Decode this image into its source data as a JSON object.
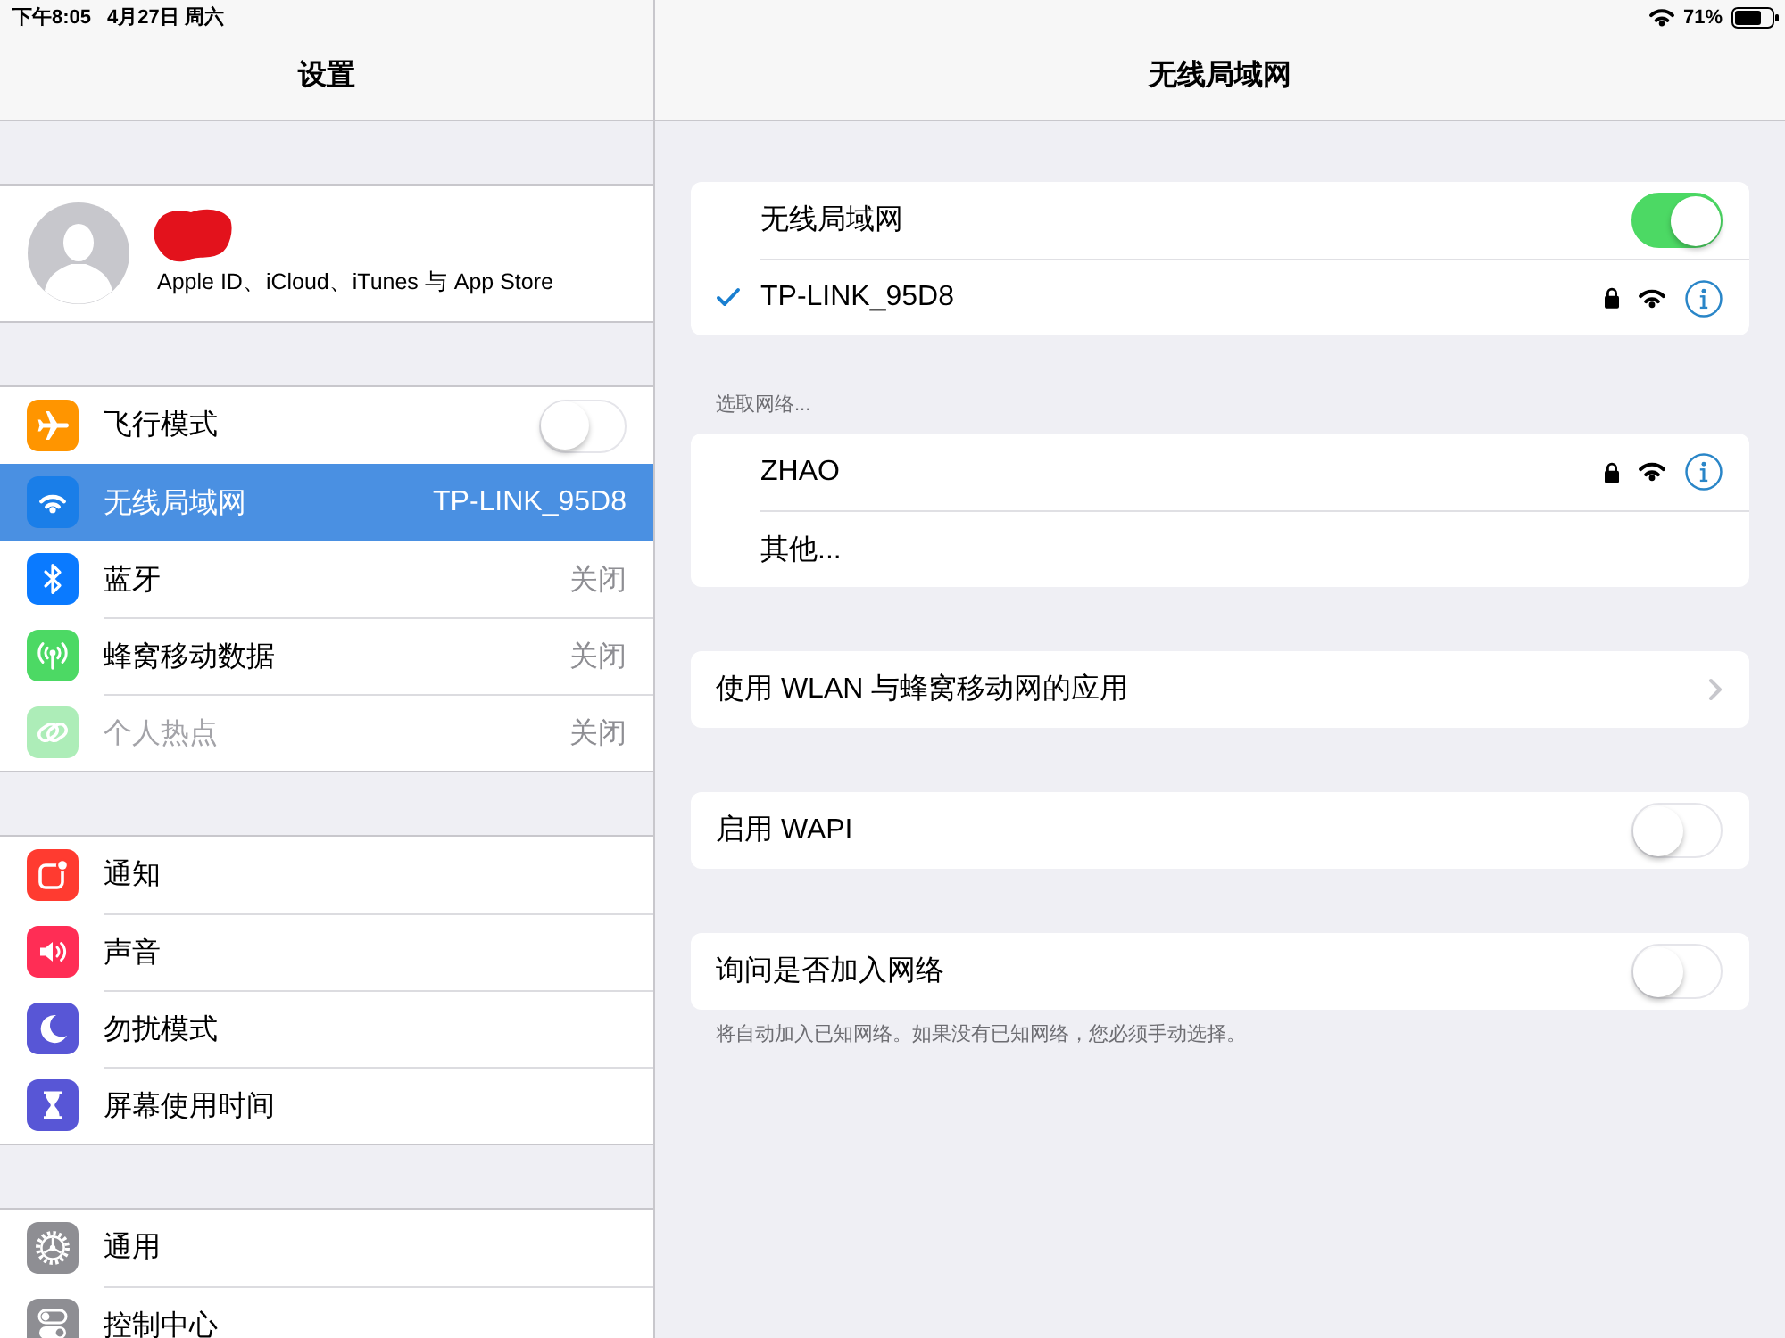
{
  "status_bar": {
    "time": "下午8:05",
    "date": "4月27日 周六",
    "battery": "71%"
  },
  "sidebar": {
    "title": "设置",
    "profile": {
      "subtitle": "Apple ID、iCloud、iTunes 与 App Store",
      "redacted": true
    },
    "groups": [
      {
        "items": [
          {
            "kind": "toggle",
            "label": "飞行模式",
            "on": false,
            "selected": false,
            "disabled": false
          },
          {
            "kind": "value",
            "label": "无线局域网",
            "value": "TP-LINK_95D8",
            "selected": true,
            "disabled": false
          },
          {
            "kind": "value",
            "label": "蓝牙",
            "value": "关闭",
            "selected": false,
            "disabled": false
          },
          {
            "kind": "value",
            "label": "蜂窝移动数据",
            "value": "关闭",
            "selected": false,
            "disabled": false
          },
          {
            "kind": "value",
            "label": "个人热点",
            "value": "关闭",
            "selected": false,
            "disabled": true
          }
        ]
      },
      {
        "items": [
          {
            "kind": "link",
            "label": "通知",
            "selected": false,
            "disabled": false
          },
          {
            "kind": "link",
            "label": "声音",
            "selected": false,
            "disabled": false
          },
          {
            "kind": "link",
            "label": "勿扰模式",
            "selected": false,
            "disabled": false
          },
          {
            "kind": "link",
            "label": "屏幕使用时间",
            "selected": false,
            "disabled": false
          }
        ]
      },
      {
        "items": [
          {
            "kind": "link",
            "label": "通用",
            "selected": false,
            "disabled": false
          },
          {
            "kind": "link",
            "label": "控制中心",
            "selected": false,
            "disabled": false
          }
        ]
      }
    ]
  },
  "detail": {
    "title": "无线局域网",
    "sections": [
      {
        "rows": [
          {
            "kind": "toggle",
            "label": "无线局域网",
            "on": true
          },
          {
            "kind": "network",
            "label": "TP-LINK_95D8",
            "checked": true,
            "locked": true
          }
        ]
      },
      {
        "header": "选取网络...",
        "rows": [
          {
            "kind": "network",
            "label": "ZHAO",
            "checked": false,
            "locked": true
          },
          {
            "kind": "other",
            "label": "其他..."
          }
        ]
      },
      {
        "rows": [
          {
            "kind": "link",
            "label": "使用 WLAN 与蜂窝移动网的应用"
          }
        ]
      },
      {
        "rows": [
          {
            "kind": "toggle",
            "label": "启用 WAPI",
            "on": false
          }
        ]
      },
      {
        "rows": [
          {
            "kind": "toggle",
            "label": "询问是否加入网络",
            "on": false
          }
        ],
        "footer": "将自动加入已知网络。如果没有已知网络，您必须手动选择。"
      }
    ]
  }
}
